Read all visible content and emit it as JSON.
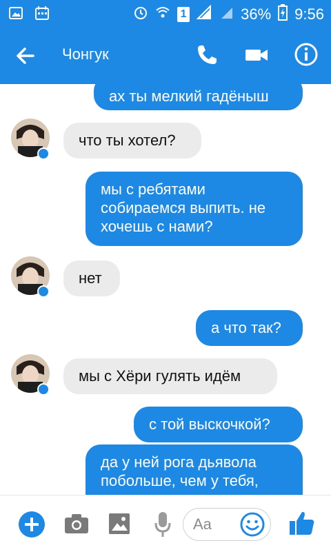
{
  "status_bar": {
    "battery_percent": "36%",
    "time": "9:56",
    "sim_label": "1"
  },
  "header": {
    "title": "Чонгук"
  },
  "messages": [
    {
      "side": "out",
      "text": "ах ты мелкий гадёныш"
    },
    {
      "side": "in",
      "text": "что ты хотел?"
    },
    {
      "side": "out",
      "text": "мы с ребятами\nсобираемся выпить. не\nхочешь с нами?"
    },
    {
      "side": "in",
      "text": "нет"
    },
    {
      "side": "out",
      "text": "а что так?"
    },
    {
      "side": "in",
      "text": "мы с Хёри гулять идём"
    },
    {
      "side": "out",
      "text": "с той выскочкой?"
    },
    {
      "side": "out",
      "text": "да у ней рога дьявола\nпобольше, чем у тебя,"
    }
  ],
  "composer": {
    "placeholder": "Aa"
  },
  "colors": {
    "accent": "#1e88e5",
    "incoming_bubble": "#ebebeb"
  }
}
